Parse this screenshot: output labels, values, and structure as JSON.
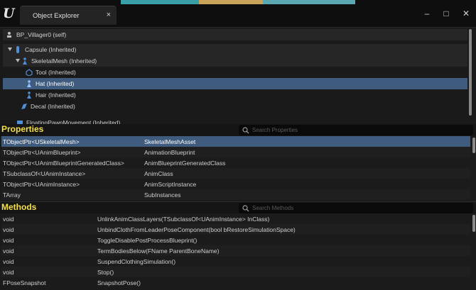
{
  "window": {
    "tab_title": "Object Explorer",
    "tab_close": "×",
    "logo": "U",
    "controls": {
      "minimize": "–",
      "maximize": "□",
      "close": "✕"
    }
  },
  "tree": {
    "root": "BP_Villager0 (self)",
    "items": [
      {
        "label": "Capsule (Inherited)",
        "icon": "capsule-component-icon"
      },
      {
        "label": "SkeletalMesh (Inherited)",
        "icon": "skeletal-mesh-icon"
      },
      {
        "label": "Tool (Inherited)",
        "icon": "static-mesh-icon"
      },
      {
        "label": "Hat (Inherited)",
        "icon": "skeletal-mesh-icon"
      },
      {
        "label": "Hair (Inherited)",
        "icon": "skeletal-mesh-icon"
      },
      {
        "label": "Decal (Inherited)",
        "icon": "decal-icon"
      },
      {
        "label": "FloatingPawnMovement (Inherited)",
        "icon": "movement-icon"
      }
    ]
  },
  "properties": {
    "title": "Properties",
    "search_placeholder": "Search Properties",
    "rows": [
      {
        "type": "TObjectPtr<USkeletalMesh>",
        "name": "SkeletalMeshAsset"
      },
      {
        "type": "TObjectPtr<UAnimBlueprint>",
        "name": "AnimationBlueprint"
      },
      {
        "type": "TObjectPtr<UAnimBlueprintGeneratedClass>",
        "name": "AnimBlueprintGeneratedClass"
      },
      {
        "type": "TSubclassOf<UAnimInstance>",
        "name": "AnimClass"
      },
      {
        "type": "TObjectPtr<UAnimInstance>",
        "name": "AnimScriptInstance"
      },
      {
        "type": "TArray",
        "name": "SubInstances"
      }
    ]
  },
  "methods": {
    "title": "Methods",
    "search_placeholder": "Search Methods",
    "rows": [
      {
        "ret": "void",
        "sig": "UnlinkAnimClassLayers(TSubclassOf<UAnimInstance>  InClass)"
      },
      {
        "ret": "void",
        "sig": "UnbindClothFromLeaderPoseComponent(bool bRestoreSimulationSpace)"
      },
      {
        "ret": "void",
        "sig": "ToggleDisablePostProcessBlueprint()"
      },
      {
        "ret": "void",
        "sig": "TermBodiesBelow(FName ParentBoneName)"
      },
      {
        "ret": "void",
        "sig": "SuspendClothingSimulation()"
      },
      {
        "ret": "void",
        "sig": "Stop()"
      },
      {
        "ret": "FPoseSnapshot",
        "sig": "SnapshotPose()"
      }
    ]
  },
  "colors": {
    "accent_yellow": "#f5e04a",
    "selection": "#3f5b7e",
    "icon_blue": "#4f8fd8"
  }
}
